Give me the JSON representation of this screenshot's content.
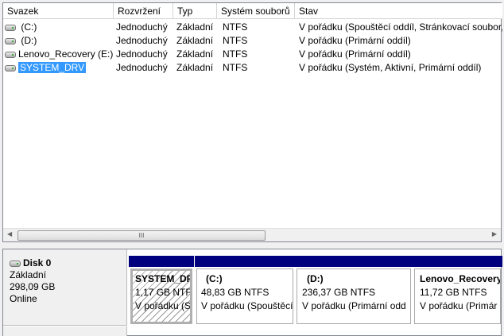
{
  "columns": [
    "Svazek",
    "Rozvržení",
    "Typ",
    "Systém souborů",
    "Stav"
  ],
  "volumes": [
    {
      "name": "(C:)",
      "layout": "Jednoduchý",
      "type": "Základní",
      "fs": "NTFS",
      "status": "V pořádku (Spouštěcí oddíl, Stránkovací soubor, S"
    },
    {
      "name": "(D:)",
      "layout": "Jednoduchý",
      "type": "Základní",
      "fs": "NTFS",
      "status": "V pořádku (Primární oddíl)"
    },
    {
      "name": "Lenovo_Recovery (E:)",
      "layout": "Jednoduchý",
      "type": "Základní",
      "fs": "NTFS",
      "status": "V pořádku (Primární oddíl)"
    },
    {
      "name": "SYSTEM_DRV",
      "layout": "Jednoduchý",
      "type": "Základní",
      "fs": "NTFS",
      "status": "V pořádku (Systém, Aktivní, Primární oddíl)"
    }
  ],
  "scroll_thumb": "III",
  "disk": {
    "name": "Disk 0",
    "type": "Základní",
    "size": "298,09 GB",
    "state": "Online"
  },
  "partitions": [
    {
      "name": "SYSTEM_DR",
      "size": "1,17 GB NTFS",
      "status": "V pořádku (S"
    },
    {
      "name": "(C:)",
      "size": "48,83 GB NTFS",
      "status": "V pořádku (Spouštěcí"
    },
    {
      "name": "(D:)",
      "size": "236,37 GB NTFS",
      "status": "V pořádku (Primární odd"
    },
    {
      "name": "Lenovo_Recovery",
      "size": "11,72 GB NTFS",
      "status": "V pořádku (Primár"
    }
  ]
}
